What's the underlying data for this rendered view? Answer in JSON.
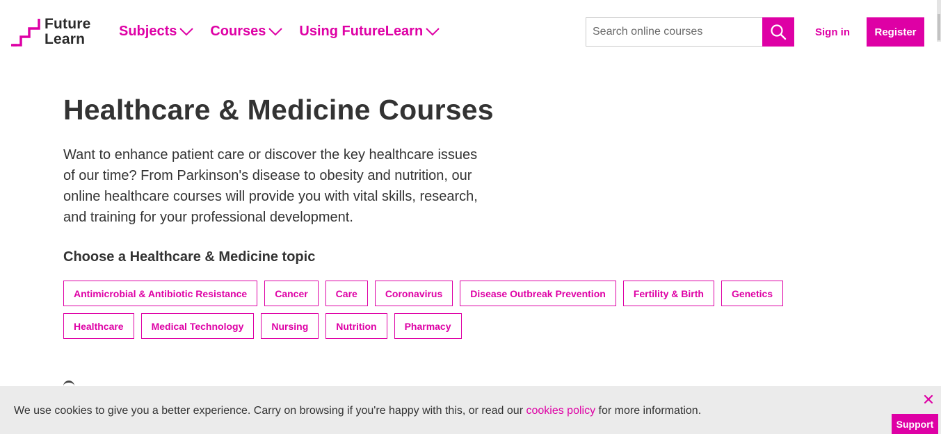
{
  "brand": {
    "name_line1": "Future",
    "name_line2": "Learn",
    "accent_color": "#de00a5"
  },
  "nav": {
    "items": [
      {
        "label": "Subjects",
        "icon": "chevron-down-icon"
      },
      {
        "label": "Courses",
        "icon": "chevron-down-icon"
      },
      {
        "label": "Using FutureLearn",
        "icon": "chevron-down-icon"
      }
    ]
  },
  "search": {
    "placeholder": "Search online courses",
    "value": "",
    "icon": "search-icon"
  },
  "auth": {
    "signin_label": "Sign in",
    "register_label": "Register"
  },
  "page": {
    "title": "Healthcare & Medicine Courses",
    "intro": "Want to enhance patient care or discover the key healthcare issues of our time? From Parkinson's disease to obesity and nutrition, our online healthcare courses will provide you with vital skills, research, and training for your professional development.",
    "topic_heading": "Choose a Healthcare & Medicine topic",
    "topics": [
      "Antimicrobial & Antibiotic Resistance",
      "Cancer",
      "Care",
      "Coronavirus",
      "Disease Outbreak Prevention",
      "Fertility & Birth",
      "Genetics",
      "Healthcare",
      "Medical Technology",
      "Nursing",
      "Nutrition",
      "Pharmacy"
    ]
  },
  "cookie_banner": {
    "text_before": "We use cookies to give you a better experience. Carry on browsing if you're happy with this, or read our ",
    "link_text": "cookies policy",
    "text_after": " for more information.",
    "close_icon": "close-icon"
  },
  "support": {
    "label": "Support"
  }
}
